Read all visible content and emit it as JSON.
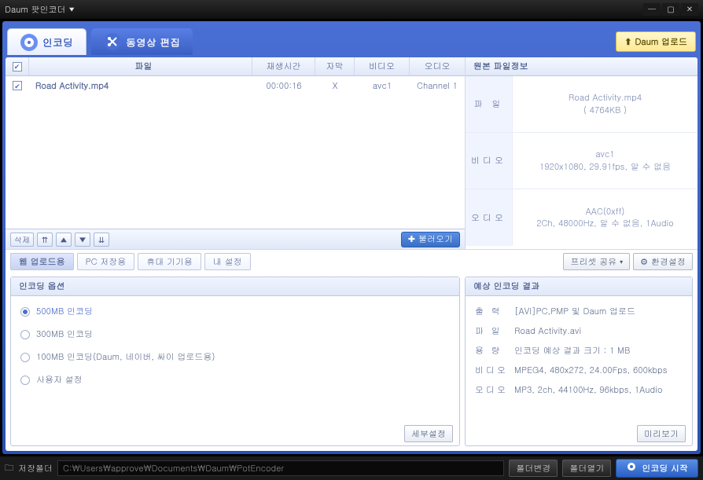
{
  "title": "Daum 팟인코더",
  "tabs": {
    "encode": "인코딩",
    "edit": "동영상 편집"
  },
  "upload_btn": "Daum 업로드",
  "filelist": {
    "headers": {
      "file": "파일",
      "duration": "재생시간",
      "subtitle": "자막",
      "video": "비디오",
      "audio": "오디오"
    },
    "rows": [
      {
        "file": "Road Activity.mp4",
        "duration": "00:00:16",
        "subtitle": "X",
        "video": "avc1",
        "audio": "Channel 1"
      }
    ],
    "delete": "삭제",
    "load": "불러오기"
  },
  "source": {
    "title": "원본 파일정보",
    "rows": {
      "file": {
        "label": "파 일",
        "line1": "Road Activity.mp4",
        "line2": "( 4764KB )"
      },
      "video": {
        "label": "비디오",
        "line1": "avc1",
        "line2": "1920x1080, 29.91fps, 알 수 없음"
      },
      "audio": {
        "label": "오디오",
        "line1": "AAC(0xff)",
        "line2": "2Ch, 48000Hz, 알 수 없음, 1Audio"
      }
    }
  },
  "subtabs": {
    "web": "웹 업로드용",
    "pc": "PC 저장용",
    "mobile": "휴대 기기용",
    "my": "내 설정"
  },
  "preset_share": "프리셋 공유",
  "settings": "환경설정",
  "options": {
    "title": "인코딩 옵션",
    "items": [
      "500MB 인코딩",
      "300MB 인코딩",
      "100MB 인코딩(Daum, 네이버, 싸이 업로드용)",
      "사용자 설정"
    ],
    "detail": "세부설정"
  },
  "result": {
    "title": "예상 인코딩 결과",
    "rows": [
      {
        "label": "출 력",
        "val": "[AVI]PC,PMP 및 Daum 업로드"
      },
      {
        "label": "파 일",
        "val": "Road Activity.avi"
      },
      {
        "label": "용 량",
        "val": "인코딩 예상 결과 크기 : 1 MB"
      },
      {
        "label": "비디오",
        "val": "MPEG4, 480x272, 24.00Fps, 600kbps"
      },
      {
        "label": "오디오",
        "val": "MP3, 2ch, 44100Hz, 96kbps, 1Audio"
      }
    ],
    "preview": "미리보기"
  },
  "status": {
    "folder_label": "저장폴더",
    "path": "C:\\Users\\approve\\Documents\\Daum\\PotEncoder",
    "change": "폴더변경",
    "open": "폴더열기",
    "start": "인코딩 시작"
  }
}
